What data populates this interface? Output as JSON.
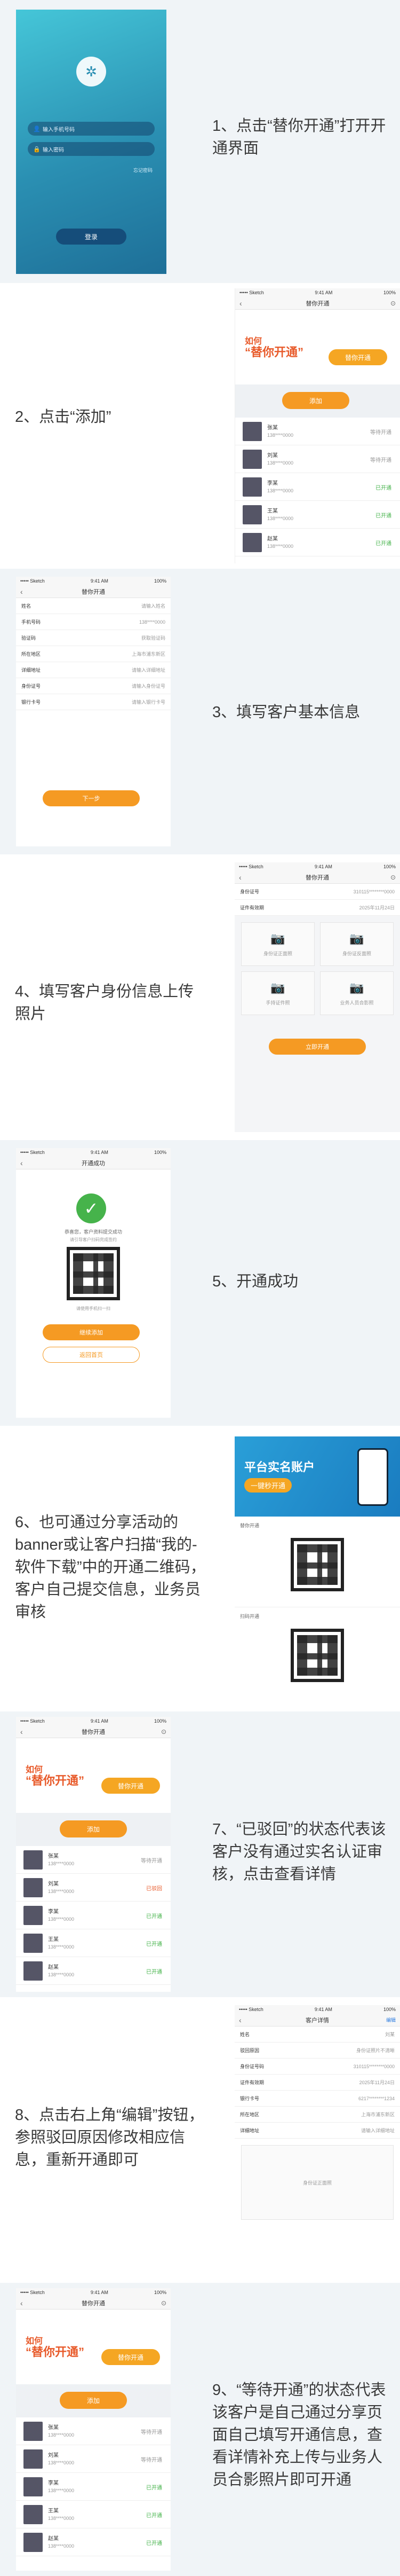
{
  "steps": [
    {
      "caption": "1、点击“替你开通”打开开通界面"
    },
    {
      "caption": "2、点击“添加”"
    },
    {
      "caption": "3、填写客户基本信息"
    },
    {
      "caption": "4、填写客户身份信息上传照片"
    },
    {
      "caption": "5、开通成功"
    },
    {
      "caption": "6、也可通过分享活动的banner或让客户扫描“我的-软件下载”中的开通二维码，客户自己提交信息，业务员审核"
    },
    {
      "caption": "7、“已驳回”的状态代表该客户没有通过实名认证审核，点击查看详情"
    },
    {
      "caption": "8、点击右上角“编辑”按钮，参照驳回原因修改相应信息，重新开通即可"
    },
    {
      "caption": "9、“等待开通”的状态代表该客户是自己通过分享页面自己填写开通信息，查看详情补充上传与业务人员合影照片即可开通"
    }
  ],
  "status_bar": {
    "carrier": "••••• Sketch",
    "time": "9:41 AM",
    "battery": "100%"
  },
  "login": {
    "username_placeholder": "输入手机号码",
    "password_placeholder": "输入密码",
    "forgot": "忘记密码",
    "login_button": "登录"
  },
  "list_screen": {
    "title": "替你开通",
    "banner_line1": "如何",
    "banner_line2": "“替你开通”",
    "banner_badge": "替你开通",
    "add_button": "添加",
    "items": [
      {
        "name": "张某",
        "phone": "138****0000",
        "status": "等待开通",
        "status_color": "#999999"
      },
      {
        "name": "刘某",
        "phone": "138****0000",
        "status": "等待开通",
        "status_color": "#999999"
      },
      {
        "name": "李某",
        "phone": "138****0000",
        "status": "已开通",
        "status_color": "#46b34b"
      },
      {
        "name": "王某",
        "phone": "138****0000",
        "status": "已开通",
        "status_color": "#46b34b"
      },
      {
        "name": "赵某",
        "phone": "138****0000",
        "status": "已开通",
        "status_color": "#46b34b"
      }
    ]
  },
  "list_screen_2": {
    "items": [
      {
        "name": "张某",
        "phone": "138****0000",
        "status": "等待开通",
        "status_color": "#999999"
      },
      {
        "name": "刘某",
        "phone": "138****0000",
        "status": "已驳回",
        "status_color": "#e85a2a"
      },
      {
        "name": "李某",
        "phone": "138****0000",
        "status": "已开通",
        "status_color": "#46b34b"
      },
      {
        "name": "王某",
        "phone": "138****0000",
        "status": "已开通",
        "status_color": "#46b34b"
      },
      {
        "name": "赵某",
        "phone": "138****0000",
        "status": "已开通",
        "status_color": "#46b34b"
      }
    ]
  },
  "form_screen": {
    "title": "替你开通",
    "rows": [
      {
        "label": "姓名",
        "value": "请输入姓名"
      },
      {
        "label": "手机号码",
        "value": "138****0000"
      },
      {
        "label": "验证码",
        "value": "获取验证码"
      },
      {
        "label": "所在地区",
        "value": "上海市浦东新区"
      },
      {
        "label": "详细地址",
        "value": "请输入详细地址"
      },
      {
        "label": "身份证号",
        "value": "请输入身份证号"
      },
      {
        "label": "银行卡号",
        "value": "请输入银行卡号"
      }
    ],
    "next_button": "下一步"
  },
  "photo_screen": {
    "title": "替你开通",
    "rows": [
      {
        "label": "身份证号",
        "value": "310115********0000"
      },
      {
        "label": "证件有效期",
        "value": "2025年11月24日"
      }
    ],
    "photos": [
      "身份证正面照",
      "身份证反面照",
      "手持证件照",
      "业务人员合影照"
    ],
    "submit_button": "立即开通"
  },
  "success_screen": {
    "title": "开通成功",
    "message": "恭喜您，客户资料提交成功",
    "sub": "请引导客户扫码完成签约",
    "qr_caption": "请使用手机扫一扫",
    "primary_button": "继续添加",
    "secondary_button": "返回首页"
  },
  "share_screen": {
    "banner_title": "平台实名账户",
    "banner_sub": "一键秒开通",
    "label1": "替你开通",
    "label2": "扫码开通"
  },
  "edit_screen": {
    "title": "客户详情",
    "edit": "编辑",
    "rows": [
      {
        "label": "姓名",
        "value": "刘某"
      },
      {
        "label": "驳回原因",
        "value": "身份证照片不清晰"
      },
      {
        "label": "身份证号码",
        "value": "310115********0000"
      },
      {
        "label": "证件有效期",
        "value": "2025年11月24日"
      },
      {
        "label": "银行卡号",
        "value": "6217********1234"
      },
      {
        "label": "所在地区",
        "value": "上海市浦东新区"
      },
      {
        "label": "详细地址",
        "value": "请输入详细地址"
      }
    ],
    "upload_label": "身份证正面照"
  }
}
